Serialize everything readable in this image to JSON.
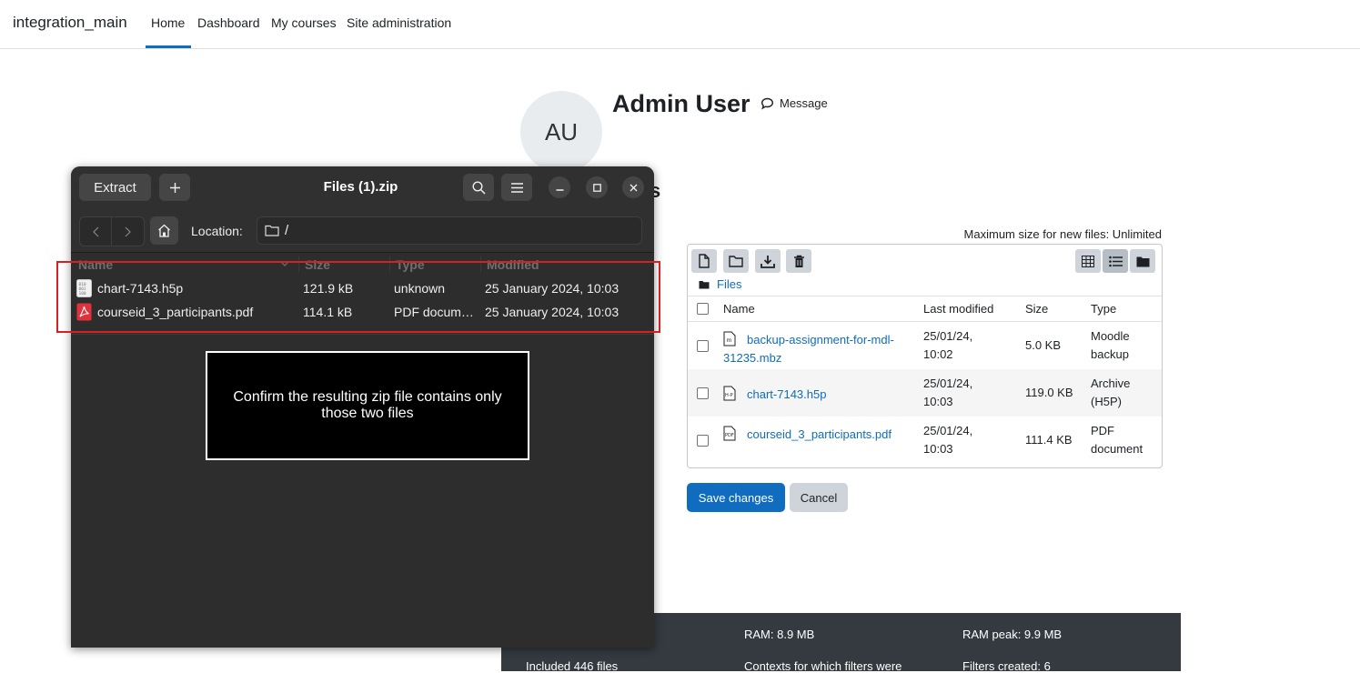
{
  "navbar": {
    "brand": "integration_main",
    "items": [
      {
        "label": "Home",
        "active": true
      },
      {
        "label": "Dashboard",
        "active": false
      },
      {
        "label": "My courses",
        "active": false
      },
      {
        "label": "Site administration",
        "active": false
      }
    ],
    "accent_color": "#0f6cbf"
  },
  "profile": {
    "initials": "AU",
    "name": "Admin User",
    "message_label": "Message",
    "partial_heading": "s"
  },
  "file_manager": {
    "max_size_text": "Maximum size for new files: Unlimited",
    "toolbar_icons": [
      "add-file-icon",
      "create-folder-icon",
      "download-icon",
      "delete-icon"
    ],
    "view_icons": [
      "grid-view-icon",
      "list-view-icon",
      "tree-view-icon"
    ],
    "active_view": "list",
    "path_label": "Files",
    "columns": [
      "Name",
      "Last modified",
      "Size",
      "Type"
    ],
    "rows": [
      {
        "name": "backup-assignment-for-mdl-31235.mbz",
        "modified": "25/01/24, 10:02",
        "size": "5.0 KB",
        "type": "Moodle backup",
        "icon": "moodle-backup-file-icon"
      },
      {
        "name": "chart-7143.h5p",
        "modified": "25/01/24, 10:03",
        "size": "119.0 KB",
        "type": "Archive (H5P)",
        "icon": "h5p-file-icon"
      },
      {
        "name": "courseid_3_participants.pdf",
        "modified": "25/01/24, 10:03",
        "size": "111.4 KB",
        "type": "PDF document",
        "icon": "pdf-file-icon"
      }
    ],
    "save_label": "Save changes",
    "cancel_label": "Cancel"
  },
  "footer": {
    "ram": "RAM: 8.9 MB",
    "ram_peak": "RAM peak: 9.9 MB",
    "included": "Included 446 files",
    "contexts": "Contexts for which filters were",
    "filters": "Filters created: 6"
  },
  "archive_window": {
    "extract_label": "Extract",
    "title": "Files (1).zip",
    "location_label": "Location:",
    "location_value": "/",
    "columns": [
      "Name",
      "Size",
      "Type",
      "Modified"
    ],
    "files": [
      {
        "name": "chart-7143.h5p",
        "size": "121.9 kB",
        "type": "unknown",
        "modified": "25 January 2024, 10:03",
        "icon": "binary-file-icon"
      },
      {
        "name": "courseid_3_participants.pdf",
        "size": "114.1 kB",
        "type": "PDF docum…",
        "modified": "25 January 2024, 10:03",
        "icon": "pdf-file-icon"
      }
    ]
  },
  "annotation": {
    "text": "Confirm the resulting zip file contains only those two files",
    "highlight_color": "#d82020"
  }
}
